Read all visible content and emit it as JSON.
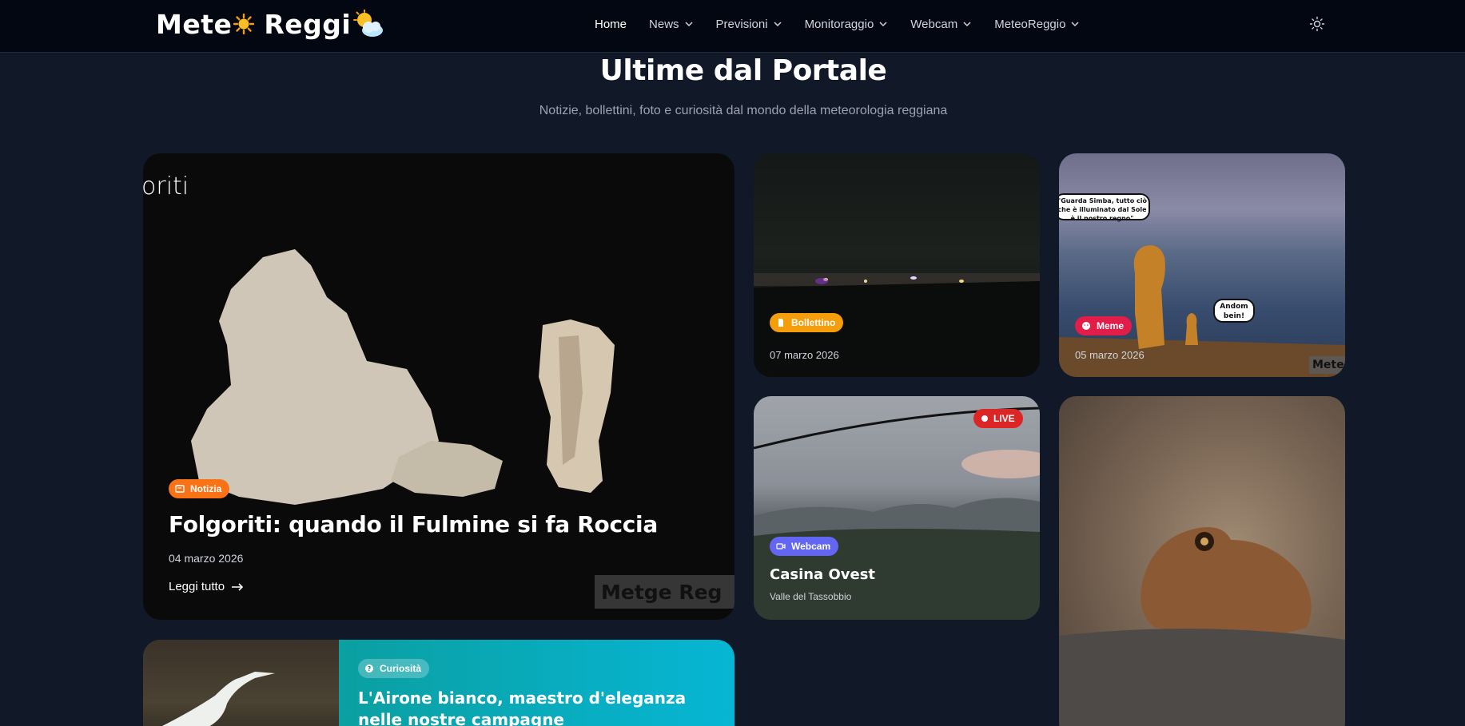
{
  "brand": {
    "logo_text_1": "Mete",
    "logo_text_2": "Reggi"
  },
  "nav": {
    "items": [
      {
        "label": "Home",
        "active": true,
        "dropdown": false
      },
      {
        "label": "News",
        "dropdown": true
      },
      {
        "label": "Previsioni",
        "dropdown": true
      },
      {
        "label": "Monitoraggio",
        "dropdown": true
      },
      {
        "label": "Webcam",
        "dropdown": true
      },
      {
        "label": "MeteoReggio",
        "dropdown": true
      }
    ],
    "theme_icon": "sun-icon"
  },
  "header": {
    "title": "Ultime dal Portale",
    "subtitle": "Notizie, bollettini, foto e curiosità dal mondo della meteorologia reggiana"
  },
  "cards": {
    "main": {
      "image_text": "oriti",
      "badge": "Notizia",
      "badge_color": "#f97316",
      "title": "Folgoriti: quando il Fulmine si fa Roccia",
      "date": "04 marzo 2026",
      "read_more": "Leggi tutto",
      "watermark": "Metge  Reg"
    },
    "bollettino": {
      "badge": "Bollettino",
      "badge_color": "#f59e0b",
      "date": "07 marzo 2026"
    },
    "meme": {
      "badge": "Meme",
      "badge_color": "#e11d48",
      "date": "05 marzo 2026",
      "bubble_1": "\"Guarda Simba, tutto ciò che è illuminato dal Sole è il nostro regno\"",
      "bubble_2": "Andom bein!",
      "watermark": "Mete"
    },
    "webcam": {
      "live": "LIVE",
      "badge": "Webcam",
      "badge_color": "#6366f1",
      "title": "Casina Ovest",
      "location": "Valle del Tassobbio"
    },
    "curiosita": {
      "badge": "Curiosità",
      "badge_color": "#2dd4bf",
      "title": "L'Airone bianco, maestro d'eleganza nelle nostre campagne"
    }
  }
}
